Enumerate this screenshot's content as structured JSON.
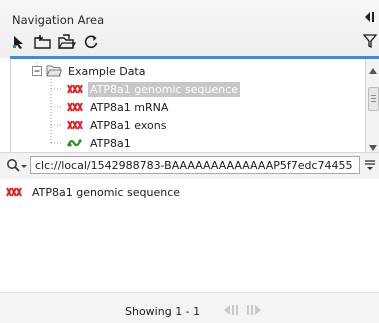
{
  "header": {
    "title": "Navigation Area",
    "accent_color": "#4b86d1",
    "tools": [
      "pointer-icon",
      "folder-add-icon",
      "folder-open-icon",
      "refresh-icon"
    ],
    "collapse_icon": "collapse-panel-icon",
    "filter_icon": "filter-icon"
  },
  "tree": {
    "items": [
      {
        "label": "Example Data",
        "icon": "folder-open-icon",
        "level": 0,
        "selected": false,
        "expanded": true
      },
      {
        "label": "ATP8a1 genomic sequence",
        "icon": "sequence-icon",
        "level": 1,
        "selected": true
      },
      {
        "label": "ATP8a1 mRNA",
        "icon": "sequence-icon",
        "level": 1,
        "selected": false
      },
      {
        "label": "ATP8a1 exons",
        "icon": "sequence-icon",
        "level": 1,
        "selected": false
      },
      {
        "label": "ATP8a1",
        "icon": "protein-icon",
        "level": 1,
        "selected": false
      }
    ]
  },
  "search": {
    "value": "clc://local/1542988783-BAAAAAAAAAAAAAP5f7edc74455",
    "icon": "search-icon"
  },
  "results": [
    {
      "label": "ATP8a1 genomic sequence",
      "icon": "sequence-icon"
    }
  ],
  "footer": {
    "showing": "Showing 1 - 1"
  }
}
